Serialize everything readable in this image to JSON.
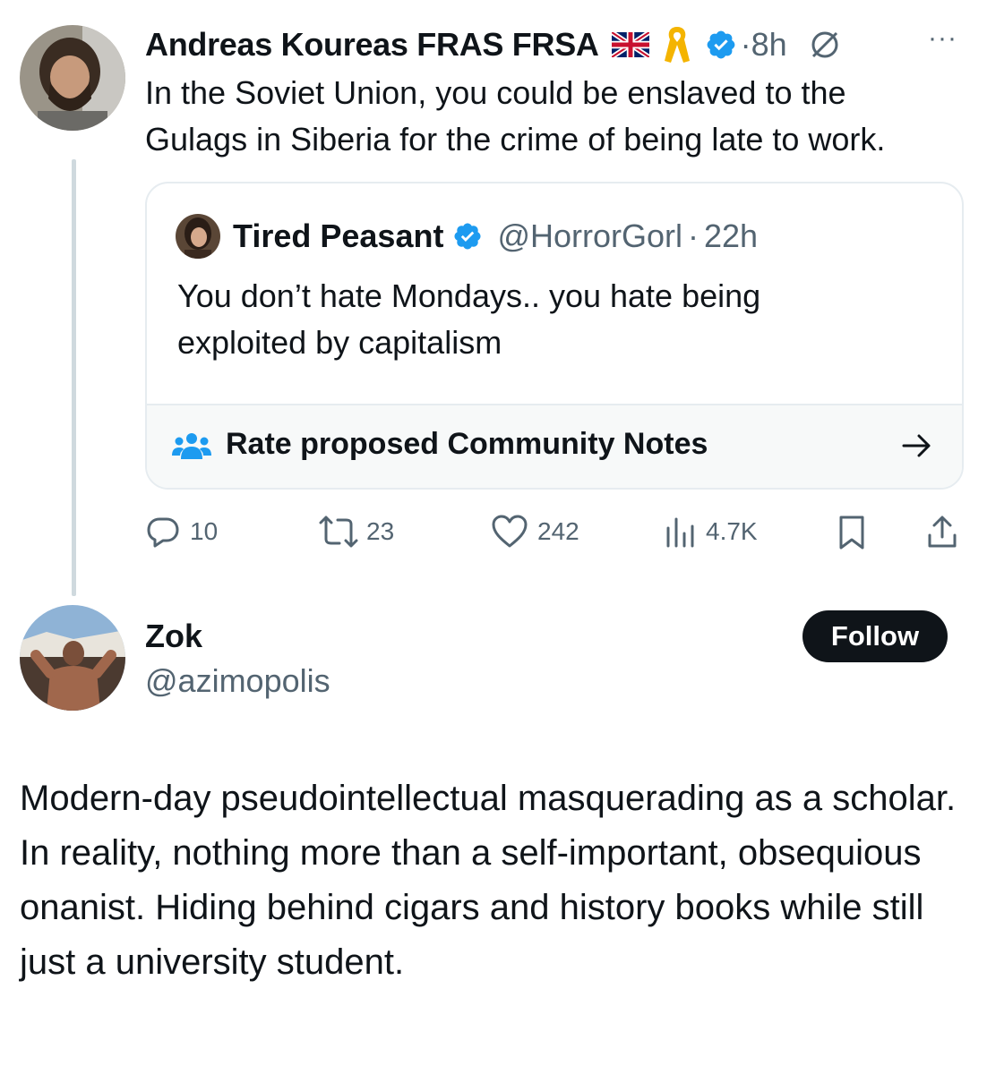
{
  "tweet": {
    "author_name": "Andreas Koureas FRAS FRSA",
    "time": "8h",
    "dot": "·",
    "more_label": "···",
    "text_line1": "In the Soviet Union, you could be enslaved to the",
    "text_line2": "Gulags in Siberia for the crime of being late to work.",
    "quote": {
      "author_name": "Tired Peasant",
      "handle": "@HorrorGorl",
      "time": "22h",
      "text_line1": "You don’t hate Mondays.. you hate being",
      "text_line2": "exploited by capitalism",
      "notes_label": "Rate proposed Community Notes"
    },
    "actions": {
      "replies": "10",
      "reposts": "23",
      "likes": "242",
      "views": "4.7K"
    }
  },
  "profile": {
    "name": "Zok",
    "handle": "@azimopolis",
    "follow_label": "Follow",
    "bio": "Modern-day pseudointellectual masquerading as a scholar. In reality, nothing more than a self-important, obsequious onanist. Hiding behind cigars and history books while still just a university student."
  },
  "colors": {
    "verified": "#1d9bf0",
    "text": "#0f1419",
    "muted": "#536471",
    "ribbon": "#f4b400"
  }
}
